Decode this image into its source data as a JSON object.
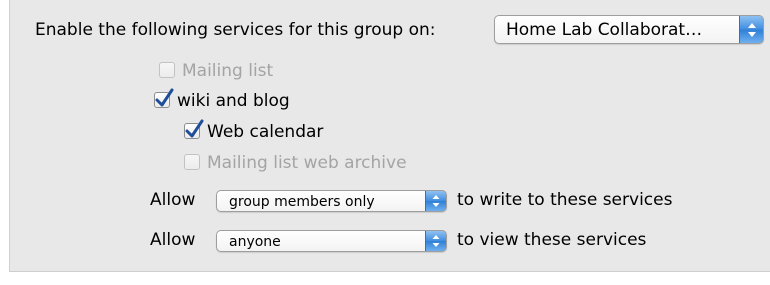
{
  "header": {
    "label": "Enable the following services for this group on:",
    "server_popup_value": "Home Lab Collaborat…"
  },
  "services": [
    {
      "label": "Mailing list",
      "checked": false,
      "enabled": false
    },
    {
      "label": "wiki and blog",
      "checked": true,
      "enabled": true
    },
    {
      "label": "Web calendar",
      "checked": true,
      "enabled": true
    },
    {
      "label": "Mailing list web archive",
      "checked": false,
      "enabled": false
    }
  ],
  "write_row": {
    "prefix": "Allow",
    "popup_value": "group members only",
    "suffix": "to write to these services"
  },
  "view_row": {
    "prefix": "Allow",
    "popup_value": "anyone",
    "suffix": "to view these services"
  },
  "colors": {
    "panel_background": "#e8e8e8",
    "checkmark": "#1f4f9a",
    "stepper_blue": "#3f8de0",
    "disabled_text": "#a4a4a4"
  },
  "icons": {
    "checkmark": "checkmark-icon",
    "stepper": "updown-arrows-icon"
  }
}
